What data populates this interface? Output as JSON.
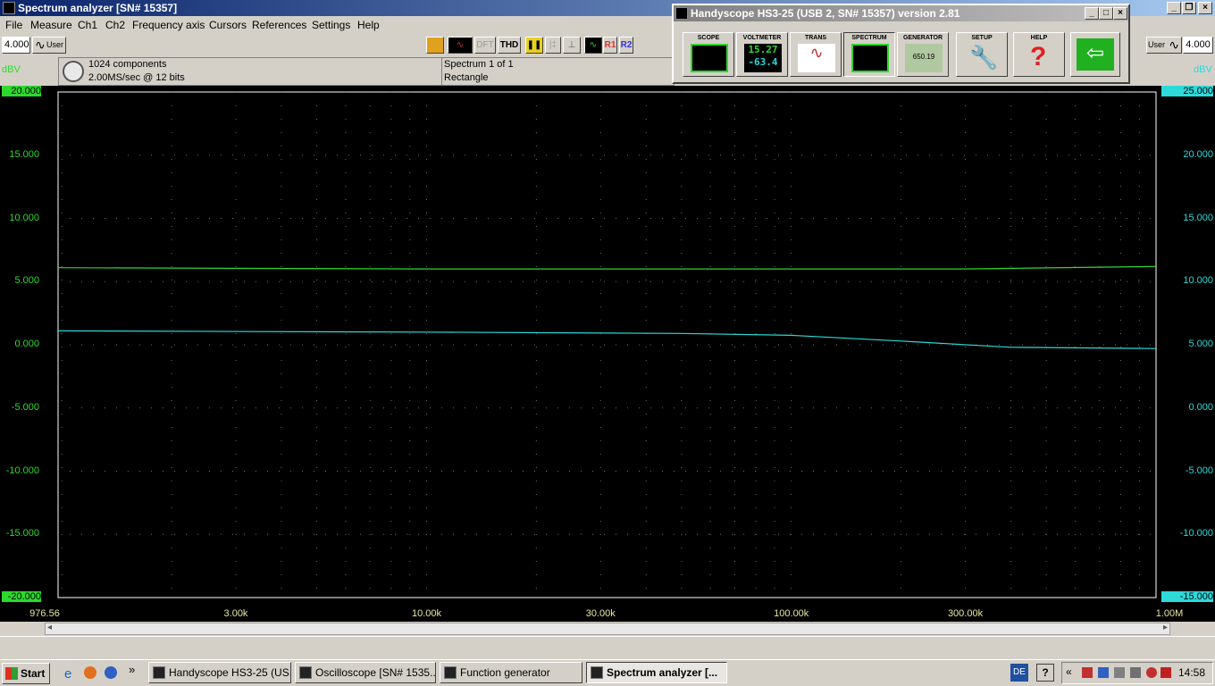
{
  "window": {
    "title": "Spectrum analyzer  [SN# 15357]"
  },
  "menu": [
    "File",
    "Measure",
    "Ch1",
    "Ch2",
    "Frequency axis",
    "Cursors",
    "References",
    "Settings",
    "Help"
  ],
  "toolbar": {
    "left_value": "4.000",
    "left_mode": "User",
    "right_value": "4.000",
    "right_mode": "User",
    "dft": "DFT",
    "thd": "THD",
    "r1": "R1",
    "r2": "R2"
  },
  "info": {
    "components": "1024 components",
    "rate": "2.00MS/sec @ 12 bits",
    "spectrum": "Spectrum 1 of 1",
    "window": "Rectangle"
  },
  "axes": {
    "left_unit": "dBV",
    "right_unit": "dBV",
    "left_ticks": [
      "20.000",
      "15.000",
      "10.000",
      "5.000",
      "0.000",
      "-5.000",
      "-10.000",
      "-15.000",
      "-20.000"
    ],
    "right_ticks": [
      "25.000",
      "20.000",
      "15.000",
      "10.000",
      "5.000",
      "0.000",
      "-5.000",
      "-10.000",
      "-15.000"
    ],
    "x_ticks": [
      "976.56",
      "3.00k",
      "10.00k",
      "30.00k",
      "100.00k",
      "300.00k",
      "1.00M"
    ],
    "left_color": "#2dd92d",
    "right_color": "#2dd9d9"
  },
  "handyscope": {
    "title": "Handyscope HS3-25 (USB 2, SN# 15357) version 2.81",
    "buttons": [
      "SCOPE",
      "VOLTMETER",
      "TRANS",
      "SPECTRUM",
      "GENERATOR",
      "SETUP",
      "HELP"
    ],
    "volt1": "15.27",
    "volt2": "-63.4",
    "gen": "650.19"
  },
  "chart_data": {
    "type": "line",
    "x_scale": "log",
    "xlim": [
      976.56,
      1000000
    ],
    "ylim": [
      -20,
      20
    ],
    "y2lim": [
      -15,
      25
    ],
    "grid": true,
    "series": [
      {
        "axis": "left",
        "color": "#2dd92d",
        "x": [
          976.56,
          10000,
          100000,
          300000,
          1000000
        ],
        "y": [
          6.1,
          6.0,
          6.0,
          6.0,
          6.2
        ]
      },
      {
        "axis": "right",
        "color": "#2dd9d9",
        "x": [
          976.56,
          10000,
          50000,
          100000,
          200000,
          400000,
          1000000
        ],
        "y": [
          6.1,
          6.0,
          5.9,
          5.75,
          5.3,
          4.8,
          4.7
        ]
      }
    ]
  },
  "taskbar": {
    "start": "Start",
    "tasks": [
      "Handyscope HS3-25 (US...",
      "Oscilloscope  [SN# 1535...",
      "Function generator",
      "Spectrum analyzer  [..."
    ],
    "lang": "DE",
    "clock": "14:58"
  }
}
